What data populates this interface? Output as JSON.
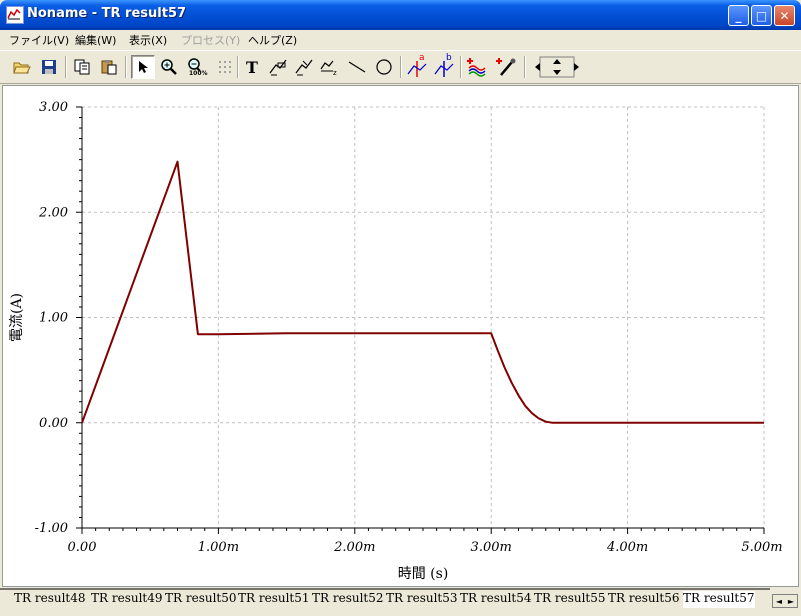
{
  "window": {
    "title": "Noname - TR result57",
    "controls": {
      "minimize": "_",
      "maximize": "□",
      "close": "✕"
    }
  },
  "menu": {
    "items": [
      {
        "label": "ファイル(V)",
        "enabled": true
      },
      {
        "label": "編集(W)",
        "enabled": true
      },
      {
        "label": "表示(X)",
        "enabled": true
      },
      {
        "label": "プロセス(Y)",
        "enabled": false
      },
      {
        "label": "ヘルプ(Z)",
        "enabled": true
      }
    ]
  },
  "toolbar": {
    "tools": [
      "open-folder-icon",
      "save-icon",
      "copy-icon",
      "paste-icon",
      "pointer-icon",
      "zoom-in-icon",
      "zoom-100-icon",
      "grid-icon",
      "text-icon",
      "cursor-label-icon",
      "cursor-label-2-icon",
      "cursor-label-3-icon",
      "line-icon",
      "circle-icon",
      "cursor-a-icon",
      "cursor-b-icon",
      "wave-add-icon",
      "probe-add-icon",
      "move-arrows-icon"
    ],
    "text_tool_label": "T",
    "zoom_label": "100%",
    "cursor_a_label": "a",
    "cursor_b_label": "b"
  },
  "chart_data": {
    "type": "line",
    "xlabel": "時間 (s)",
    "ylabel": "電流(A)",
    "xlim": [
      0,
      5.0
    ],
    "ylim": [
      -1.0,
      3.0
    ],
    "x_unit": "m",
    "xticks": [
      0.0,
      1.0,
      2.0,
      3.0,
      4.0,
      5.0
    ],
    "xtick_labels": [
      "0.00",
      "1.00m",
      "2.00m",
      "3.00m",
      "4.00m",
      "5.00m"
    ],
    "yticks": [
      -1.0,
      0.0,
      1.0,
      2.0,
      3.0
    ],
    "ytick_labels": [
      "-1.00",
      "0.00",
      "1.00",
      "2.00",
      "3.00"
    ],
    "grid": true,
    "series": [
      {
        "color": "#800000",
        "x": [
          0.0,
          0.7,
          0.85,
          1.0,
          1.5,
          2.0,
          2.5,
          3.0,
          3.05,
          3.1,
          3.15,
          3.2,
          3.25,
          3.3,
          3.35,
          3.4,
          3.45,
          3.5,
          4.0,
          5.0
        ],
        "y": [
          0.0,
          2.48,
          0.84,
          0.84,
          0.85,
          0.85,
          0.85,
          0.85,
          0.68,
          0.52,
          0.38,
          0.26,
          0.16,
          0.09,
          0.04,
          0.01,
          0.0,
          0.0,
          0.0,
          0.0
        ]
      }
    ]
  },
  "tabs": {
    "items": [
      "TR result48",
      "TR result49",
      "TR result50",
      "TR result51",
      "TR result52",
      "TR result53",
      "TR result54",
      "TR result55",
      "TR result56",
      "TR result57"
    ],
    "active": "TR result57",
    "scroll_left": "◄",
    "scroll_right": "►"
  }
}
